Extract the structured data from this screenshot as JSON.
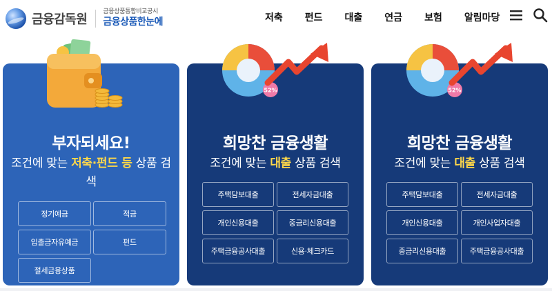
{
  "header": {
    "logo_text": "금융감독원",
    "logo_sub_top": "금융상품통합비교공시",
    "logo_sub_main": "금융상품한눈에",
    "nav": [
      "저축",
      "펀드",
      "대출",
      "연금",
      "보험",
      "알림마당"
    ],
    "menu_icon": "hamburger-menu-icon",
    "search_icon": "search-icon"
  },
  "cards": [
    {
      "title": "부자되세요!",
      "desc_before": "조건에 맞는 ",
      "desc_highlight": "저축·펀드 등",
      "desc_after": " 상품 검색",
      "illustration": "wallet-coins-icon",
      "buttons": [
        "정기예금",
        "적금",
        "입출금자유예금",
        "펀드",
        "절세금융상품"
      ]
    },
    {
      "title": "희망찬 금융생활",
      "desc_before": "조건에 맞는 ",
      "desc_highlight": "대출",
      "desc_after": " 상품 검색",
      "illustration": "donut-chart-arrow-icon",
      "chart_badge": "52%",
      "buttons": [
        "주택담보대출",
        "전세자금대출",
        "개인신용대출",
        "중금리신용대출",
        "주택금융공사대출",
        "신용·체크카드"
      ]
    },
    {
      "title": "희망찬 금융생활",
      "desc_before": "조건에 맞는 ",
      "desc_highlight": "대출",
      "desc_after": " 상품 검색",
      "illustration": "donut-chart-arrow-icon",
      "chart_badge": "52%",
      "buttons": [
        "주택담보대출",
        "전세자금대출",
        "개인신용대출",
        "개인사업자대출",
        "중금리신용대출",
        "주택금융공사대출"
      ]
    }
  ],
  "colors": {
    "card_savings": "#2d64b8",
    "card_loan": "#163a79",
    "highlight": "#ffd84a",
    "logo_blue": "#1c5bb8"
  }
}
